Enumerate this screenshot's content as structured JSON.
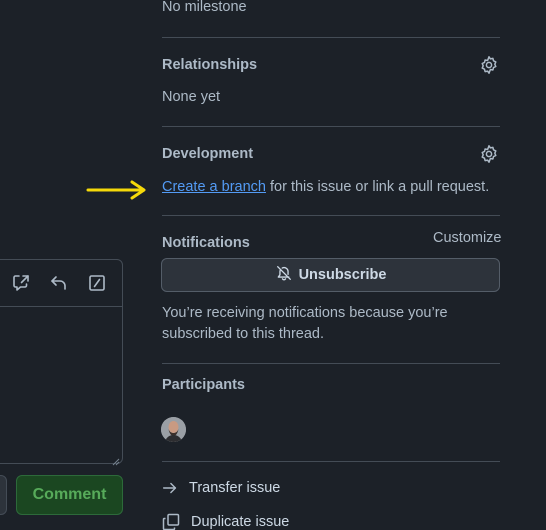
{
  "milestone": {
    "value": "No milestone"
  },
  "relationships": {
    "heading": "Relationships",
    "value": "None yet"
  },
  "development": {
    "heading": "Development",
    "link_label": "Create a branch",
    "link_suffix": " for this issue or link a pull request."
  },
  "notifications": {
    "heading": "Notifications",
    "customize_label": "Customize",
    "unsubscribe_label": "Unsubscribe",
    "reason_line1": "You’re receiving notifications because you’re",
    "reason_line2": "subscribed to this thread."
  },
  "participants": {
    "heading": "Participants"
  },
  "actions": {
    "transfer_label": "Transfer issue",
    "duplicate_label": "Duplicate issue"
  },
  "editor": {
    "comment_label": "Comment"
  },
  "colors": {
    "background": "#1c2128",
    "link": "#539bf5",
    "annotation_arrow": "#f5d90a",
    "comment_button": "#1b4721"
  },
  "icons": [
    "gear-icon",
    "bell-slash-icon",
    "arrow-right-icon",
    "duplicate-icon",
    "reference-icon",
    "reply-icon",
    "slash-command-icon"
  ]
}
